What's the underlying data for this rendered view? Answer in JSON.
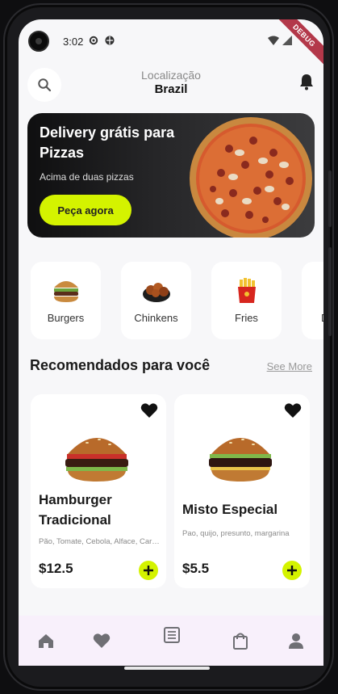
{
  "status_bar": {
    "time": "3:02",
    "debug_label": "DEBUG"
  },
  "header": {
    "location_label": "Localização",
    "location_value": "Brazil"
  },
  "banner": {
    "title": "Delivery grátis para Pizzas",
    "subtitle": "Acima de duas pizzas",
    "button_label": "Peça agora"
  },
  "categories": [
    {
      "label": "Burgers",
      "icon": "burger-icon"
    },
    {
      "label": "Chinkens",
      "icon": "chicken-icon"
    },
    {
      "label": "Fries",
      "icon": "fries-icon"
    },
    {
      "label": "D",
      "icon": "drink-icon"
    }
  ],
  "recommended": {
    "title": "Recomendados para você",
    "see_more": "See More",
    "products": [
      {
        "name": "Hamburger Tradicional",
        "description": "Pão, Tomate, Cebola, Alface, Carne",
        "price": "$12.5"
      },
      {
        "name": "Misto Especial",
        "description": "Pao, quijo, presunto, margarina",
        "price": "$5.5"
      }
    ]
  },
  "bottom_nav": [
    "home-icon",
    "heart-icon",
    "list-icon",
    "bag-icon",
    "profile-icon"
  ],
  "colors": {
    "accent": "#d4f300",
    "banner_dark": "#0f0f10",
    "nav_bg": "#f8f0fb"
  }
}
